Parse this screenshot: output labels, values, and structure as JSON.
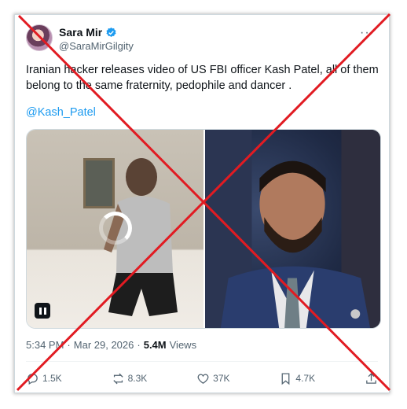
{
  "tweet": {
    "display_name": "Sara Mir",
    "handle": "@SaraMirGilgity",
    "more_icon": "more-icon",
    "text": "Iranian hacker releases video of US FBI officer Kash Patel, all of them belong to the same fraternity, pedophile and dancer .",
    "mention": "@Kash_Patel",
    "time": "5:34 PM",
    "date_sep": "·",
    "date": "Mar 29, 2026",
    "views_sep": "·",
    "views_count": "5.4M",
    "views_label": "Views"
  },
  "actions": {
    "replies": "1.5K",
    "reposts": "8.3K",
    "likes": "37K",
    "bookmarks": "4.7K"
  },
  "colors": {
    "accent": "#1d9bf0",
    "cross": "#e11b22",
    "text": "#0f1419",
    "muted": "#536471"
  }
}
